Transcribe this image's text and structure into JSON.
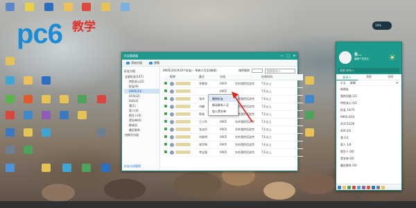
{
  "logo": {
    "brand": "pc6",
    "suffix": "教学"
  },
  "desktop_widget": {
    "text": "19%"
  },
  "window": {
    "title": "好友管理器",
    "controls": [
      "—",
      "□",
      "✕"
    ],
    "toolbar": {
      "add_group": "添加分组",
      "view": "视图"
    },
    "sidebar": {
      "header": "好友分组",
      "groups": [
        {
          "label": "全部好友(147)",
          "selected": false,
          "top": true
        },
        {
          "label": "特别关心(2)",
          "selected": false,
          "top": false
        },
        {
          "label": "好友(9)",
          "selected": false,
          "top": false
        },
        {
          "label": "0905(10)",
          "selected": true,
          "top": false
        },
        {
          "label": "419(22)",
          "selected": false,
          "top": false
        },
        {
          "label": "426(2)",
          "selected": false,
          "top": false
        },
        {
          "label": "我(1)",
          "selected": false,
          "top": false
        },
        {
          "label": "家人(4)",
          "selected": false,
          "top": false
        },
        {
          "label": "陌生人(0)",
          "selected": false,
          "top": false
        },
        {
          "label": "黑名单(0)",
          "selected": false,
          "top": false
        },
        {
          "label": "群成员",
          "selected": false,
          "top": false
        },
        {
          "label": "最近联系",
          "selected": false,
          "top": false
        },
        {
          "label": "由账号分组",
          "selected": false,
          "top": true
        }
      ],
      "link": "好友分组管理"
    },
    "content": {
      "breadcrumb": "0905(10)(共10个好友) - 所有人可见(修改)",
      "sort_label": "排序规则",
      "search_placeholder": "搜索联系人",
      "columns": [
        "",
        "昵称",
        "备注",
        "分组",
        "",
        "在线时间"
      ],
      "rows": [
        {
          "remark": "李景晋",
          "group": "0905",
          "sig": "先听我把话说完",
          "time": "7天以上"
        },
        {
          "remark": "",
          "group": "0905",
          "sig": "",
          "time": "7天以上"
        },
        {
          "remark": "张伟",
          "group": "0905",
          "sig": "先听我把话说完",
          "time": "7天以上"
        },
        {
          "remark": "刘峰",
          "group": "0905",
          "sig": "先听我把话说完",
          "time": "7天以上"
        },
        {
          "remark": "陈刚",
          "group": "0905",
          "sig": "先听我把话说完",
          "time": "7天以上"
        },
        {
          "remark": "王小军",
          "group": "0905",
          "sig": "先听我把话说完",
          "time": "7天以上"
        },
        {
          "remark": "张宝玲",
          "group": "0905",
          "sig": "先听我把话说完",
          "time": "7天以上"
        },
        {
          "remark": "刘俊明",
          "group": "0905",
          "sig": "先听我把话说完",
          "time": "7天以上"
        },
        {
          "remark": "周华坤",
          "group": "0905",
          "sig": "先听我把话说完",
          "time": "7天以上"
        },
        {
          "remark": "李宝强",
          "group": "0905",
          "sig": "先听我把话说完",
          "time": "7天以上"
        }
      ]
    },
    "context_menu": [
      "删除好友",
      "移动联系人至",
      "加入黑名单"
    ]
  },
  "chat_panel": {
    "name": "张...",
    "signature": "编辑个性签名",
    "search": "搜索:联系人",
    "tabs": [
      "联系人",
      "消息",
      "空间"
    ],
    "subtabs": [
      "好友",
      "群聊"
    ],
    "groups": [
      "新朋友",
      "我的设备 2/3",
      "特别关心 0/2",
      "好友 10/71",
      "0905 0/10",
      "419 22/26",
      "426 0/2",
      "我 1/1",
      "家人 1/4",
      "陌生人 0/0",
      "黑名单 0/0",
      "最近联系 0/0"
    ]
  },
  "colors": {
    "accent": "#219a8e",
    "selected": "#cfe3f5",
    "checkbox": "#3ba34b"
  }
}
